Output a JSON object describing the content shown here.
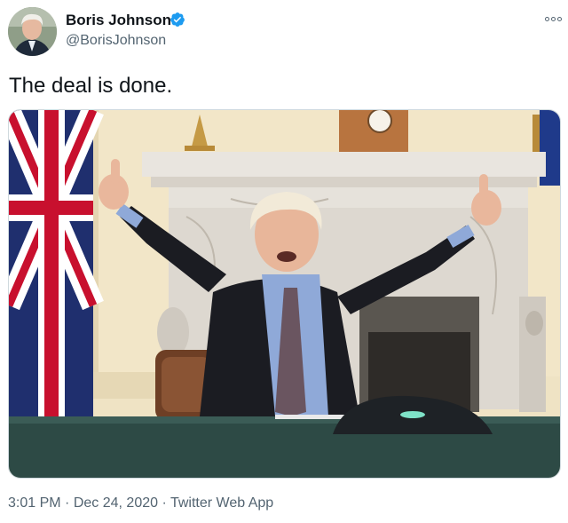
{
  "author": {
    "name": "Boris Johnson",
    "handle": "@BorisJohnson",
    "verified": true,
    "avatar_icon": "profile-photo"
  },
  "tweet": {
    "text": "The deal is done.",
    "has_photo": true
  },
  "meta": {
    "time": "3:01 PM",
    "separator": "·",
    "date": "Dec 24, 2020",
    "source": "Twitter Web App"
  },
  "colors": {
    "verified_blue": "#1d9bf0",
    "secondary_text": "#536471",
    "primary_text": "#0f1419"
  },
  "icons": {
    "more": "more-options-icon",
    "verified": "verified-badge-icon"
  }
}
